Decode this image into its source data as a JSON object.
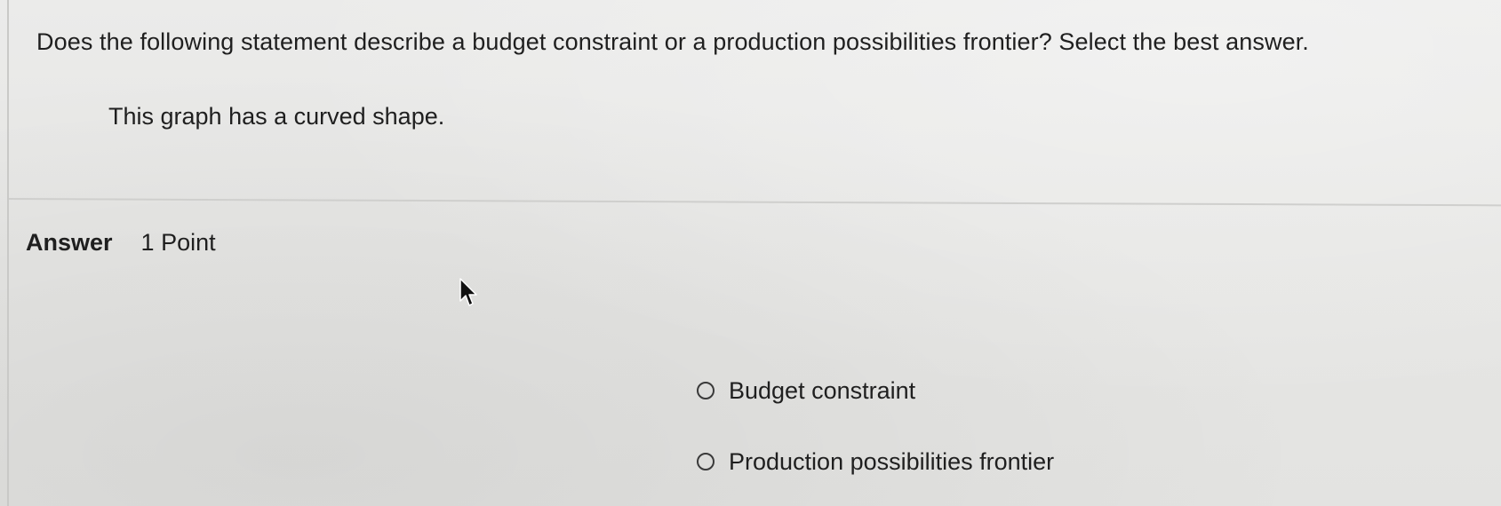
{
  "question": {
    "prompt": "Does the following statement describe a budget constraint or a production possibilities frontier? Select the best answer.",
    "statement": "This graph has a curved shape."
  },
  "answer": {
    "label": "Answer",
    "points": "1 Point",
    "options": [
      {
        "label": "Budget constraint",
        "selected": false
      },
      {
        "label": "Production possibilities frontier",
        "selected": false
      }
    ]
  },
  "colors": {
    "background": "#e8e8e6",
    "text": "#1f1f1f",
    "divider": "#cfcfcd"
  },
  "icons": {
    "cursor": "mouse-pointer-icon",
    "radio": "radio-unchecked-icon"
  }
}
